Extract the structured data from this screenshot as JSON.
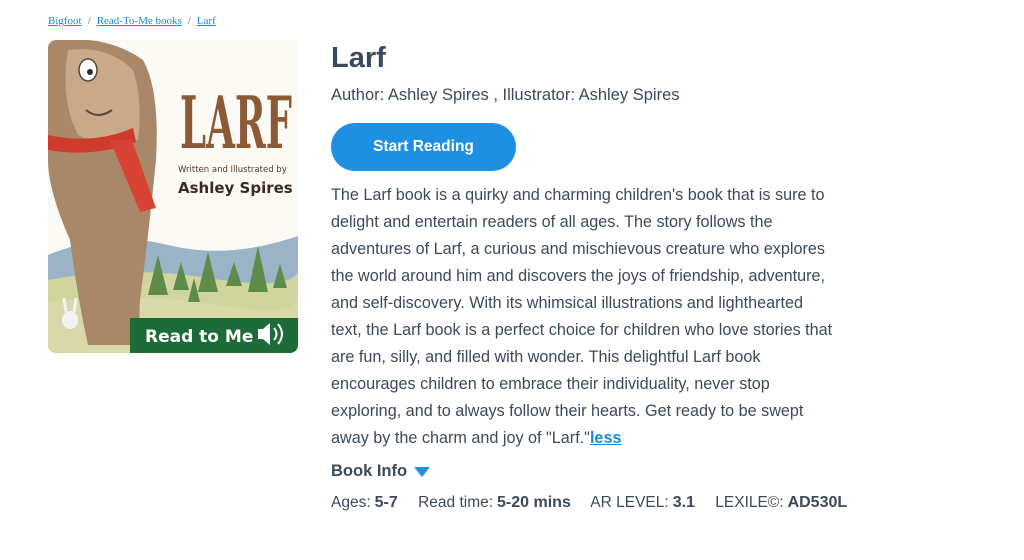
{
  "breadcrumb": [
    {
      "label": "Bigfoot"
    },
    {
      "label": "Read-To-Me books"
    },
    {
      "label": "Larf"
    }
  ],
  "breadcrumb_separator": "/",
  "cover": {
    "title_art": "LARF",
    "credit_line": "Written and Illustrated by",
    "author_art": "Ashley Spires",
    "badge_label": "Read to Me",
    "badge_icon": "speaker-icon",
    "badge_color": "#1e6b3a"
  },
  "book": {
    "title": "Larf",
    "byline": "Author: Ashley Spires , Illustrator: Ashley Spires",
    "start_button": "Start Reading",
    "description": "The Larf book is a quirky and charming children's book that is sure to delight and entertain readers of all ages. The story follows the adventures of Larf, a curious and mischievous creature who explores the world around him and discovers the joys of friendship, adventure, and self-discovery. With its whimsical illustrations and lighthearted text, the Larf book is a perfect choice for children who love stories that are fun, silly, and filled with wonder. This delightful Larf book encourages children to embrace their individuality, never stop exploring, and to always follow their hearts. Get ready to be swept away by the charm and joy of \"Larf.\"",
    "less_link": "less",
    "book_info_label": "Book Info"
  },
  "stats": {
    "ages_label": "Ages:",
    "ages": "5-7",
    "read_time_label": "Read time:",
    "read_time": "5-20 mins",
    "ar_label": "AR LEVEL:",
    "ar": "3.1",
    "lexile_label": "LEXILE©:",
    "lexile": "AD530L"
  },
  "colors": {
    "accent": "#1e8fe1",
    "link": "#1a8ad4",
    "text": "#3b4a5a"
  }
}
